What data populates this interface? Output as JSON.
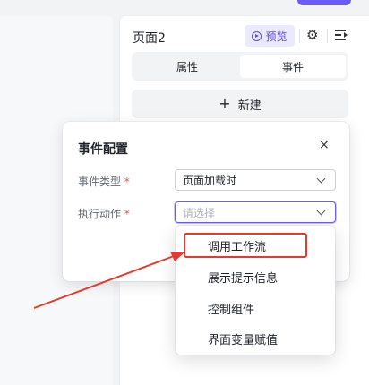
{
  "panel": {
    "title": "页面2",
    "preview_label": "预览",
    "icons": [
      "play-circle-icon",
      "gear-icon",
      "outdent-icon"
    ],
    "tabs": [
      {
        "label": "属性",
        "active": false
      },
      {
        "label": "事件",
        "active": true
      }
    ],
    "new_button": {
      "plus": "+",
      "label": "新建"
    }
  },
  "modal": {
    "title": "事件配置",
    "close": "×",
    "fields": [
      {
        "label": "事件类型",
        "required": "*",
        "value": "页面加载时",
        "placeholder": ""
      },
      {
        "label": "执行动作",
        "required": "*",
        "value": "",
        "placeholder": "请选择"
      }
    ]
  },
  "dropdown": {
    "options": [
      "调用工作流",
      "展示提示信息",
      "控制组件",
      "界面变量赋值"
    ],
    "highlighted_index": 0
  },
  "colors": {
    "accent": "#6b5cf6",
    "annotation_red": "#e6382f",
    "required": "#f54a45"
  }
}
